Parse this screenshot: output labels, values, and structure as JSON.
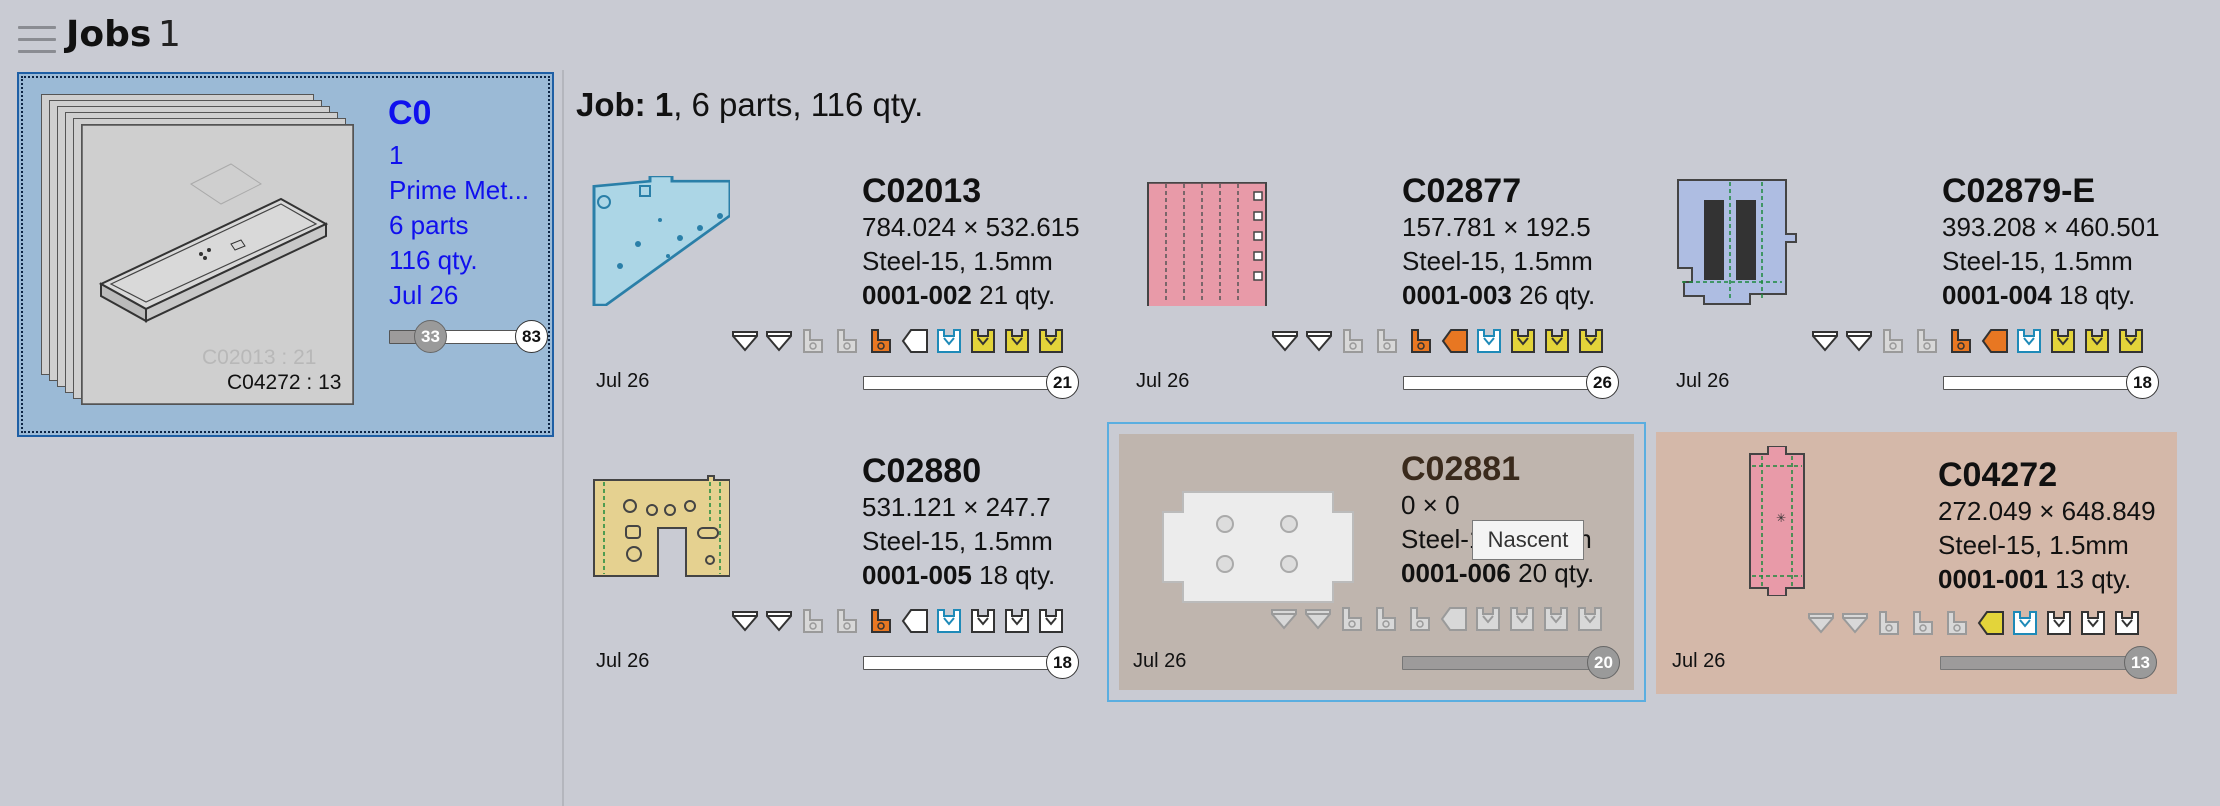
{
  "header": {
    "title": "Jobs",
    "count": "1"
  },
  "job_card": {
    "title": "C0",
    "lines": [
      "1",
      "Prime Met...",
      "6 parts",
      "116 qty.",
      "Jul 26"
    ],
    "stack_labels": [
      "C02013 : 21",
      "C04272 : 13"
    ],
    "progress_done": "33",
    "progress_total": "83"
  },
  "job_heading": {
    "label": "Job: 1",
    "rest": ", 6 parts, 116 qty."
  },
  "parts": [
    {
      "name": "C02013",
      "dims": "784.024 × 532.615",
      "material": "Steel-15, 1.5mm",
      "code": "0001-002",
      "qty": "21 qty.",
      "date": "Jul 26",
      "count": "21",
      "state": "normal",
      "progress": 0.0
    },
    {
      "name": "C02877",
      "dims": "157.781 × 192.5",
      "material": "Steel-15, 1.5mm",
      "code": "0001-003",
      "qty": "26 qty.",
      "date": "Jul 26",
      "count": "26",
      "state": "normal",
      "progress": 0.0
    },
    {
      "name": "C02879-E",
      "dims": "393.208 × 460.501",
      "material": "Steel-15, 1.5mm",
      "code": "0001-004",
      "qty": "18 qty.",
      "date": "Jul 26",
      "count": "18",
      "state": "normal",
      "progress": 0.0
    },
    {
      "name": "C02880",
      "dims": "531.121 × 247.7",
      "material": "Steel-15, 1.5mm",
      "code": "0001-005",
      "qty": "18 qty.",
      "date": "Jul 26",
      "count": "18",
      "state": "normal",
      "progress": 0.0
    },
    {
      "name": "C02881",
      "dims": "0 × 0",
      "material": "Steel-15, 1.5mm",
      "code": "0001-006",
      "qty": "20 qty.",
      "date": "Jul 26",
      "count": "20",
      "state": "nascent",
      "progress": 1.0
    },
    {
      "name": "C04272",
      "dims": "272.049 × 648.849",
      "material": "Steel-15, 1.5mm",
      "code": "0001-001",
      "qty": "13 qty.",
      "date": "Jul 26",
      "count": "13",
      "state": "done",
      "progress": 1.0
    }
  ],
  "tooltip": "Nascent",
  "colors": {
    "background": "#c9cbd3",
    "selected_card": "#9bbad6",
    "link_text": "#1010ee",
    "orange": "#e87722",
    "yellow": "#e3d43a",
    "nascent_tile": "#bfb5ae",
    "done_tile": "#d4b8a9"
  },
  "icon_names": [
    "bend-down-icon",
    "bend-up-icon",
    "punch-icon",
    "punch-icon",
    "orange-process-icon",
    "tag-icon",
    "download-icon",
    "yellow-stage-icon"
  ]
}
